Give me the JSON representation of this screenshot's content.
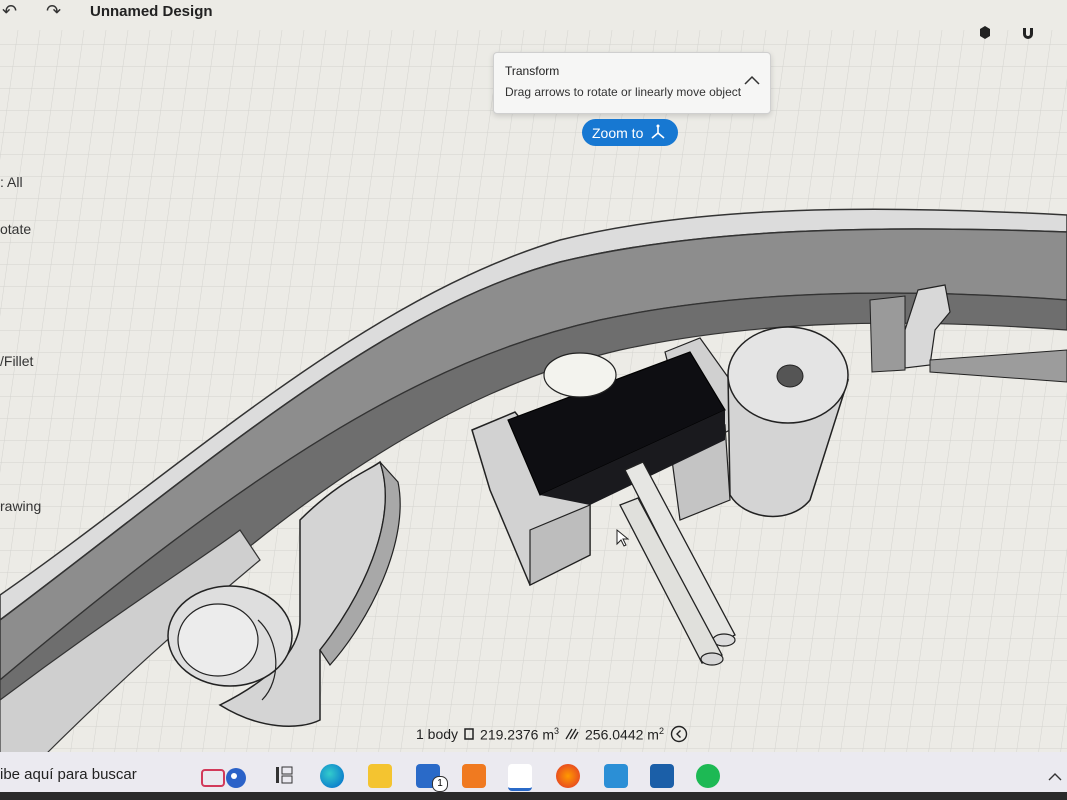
{
  "app": {
    "title": "Unnamed Design"
  },
  "toolbar": {
    "undo_icon": "undo-icon",
    "redo_icon": "redo-icon",
    "right_icons": [
      "cube-icon",
      "magnet-icon"
    ]
  },
  "left_panel": {
    "items": [
      {
        "label": ": All"
      },
      {
        "label": "otate"
      },
      {
        "label": "/Fillet"
      },
      {
        "label": "rawing"
      }
    ]
  },
  "transform_popup": {
    "title": "Transform",
    "subtitle": "Drag arrows to rotate or linearly move object"
  },
  "zoom_button": {
    "label": "Zoom to"
  },
  "status": {
    "bodies": "1 body",
    "volume": "219.2376 m",
    "volume_sup": "3",
    "area": "256.0442 m",
    "area_sup": "2"
  },
  "taskbar": {
    "search_placeholder": "ibe aquí para buscar",
    "mail_badge": "1",
    "apps": [
      "edge",
      "file-explorer",
      "mail",
      "media-player",
      "shapr3d",
      "firefox",
      "store",
      "skype",
      "spotify"
    ]
  },
  "colors": {
    "accent": "#1778d2",
    "grid_bg": "#ecebe6"
  }
}
